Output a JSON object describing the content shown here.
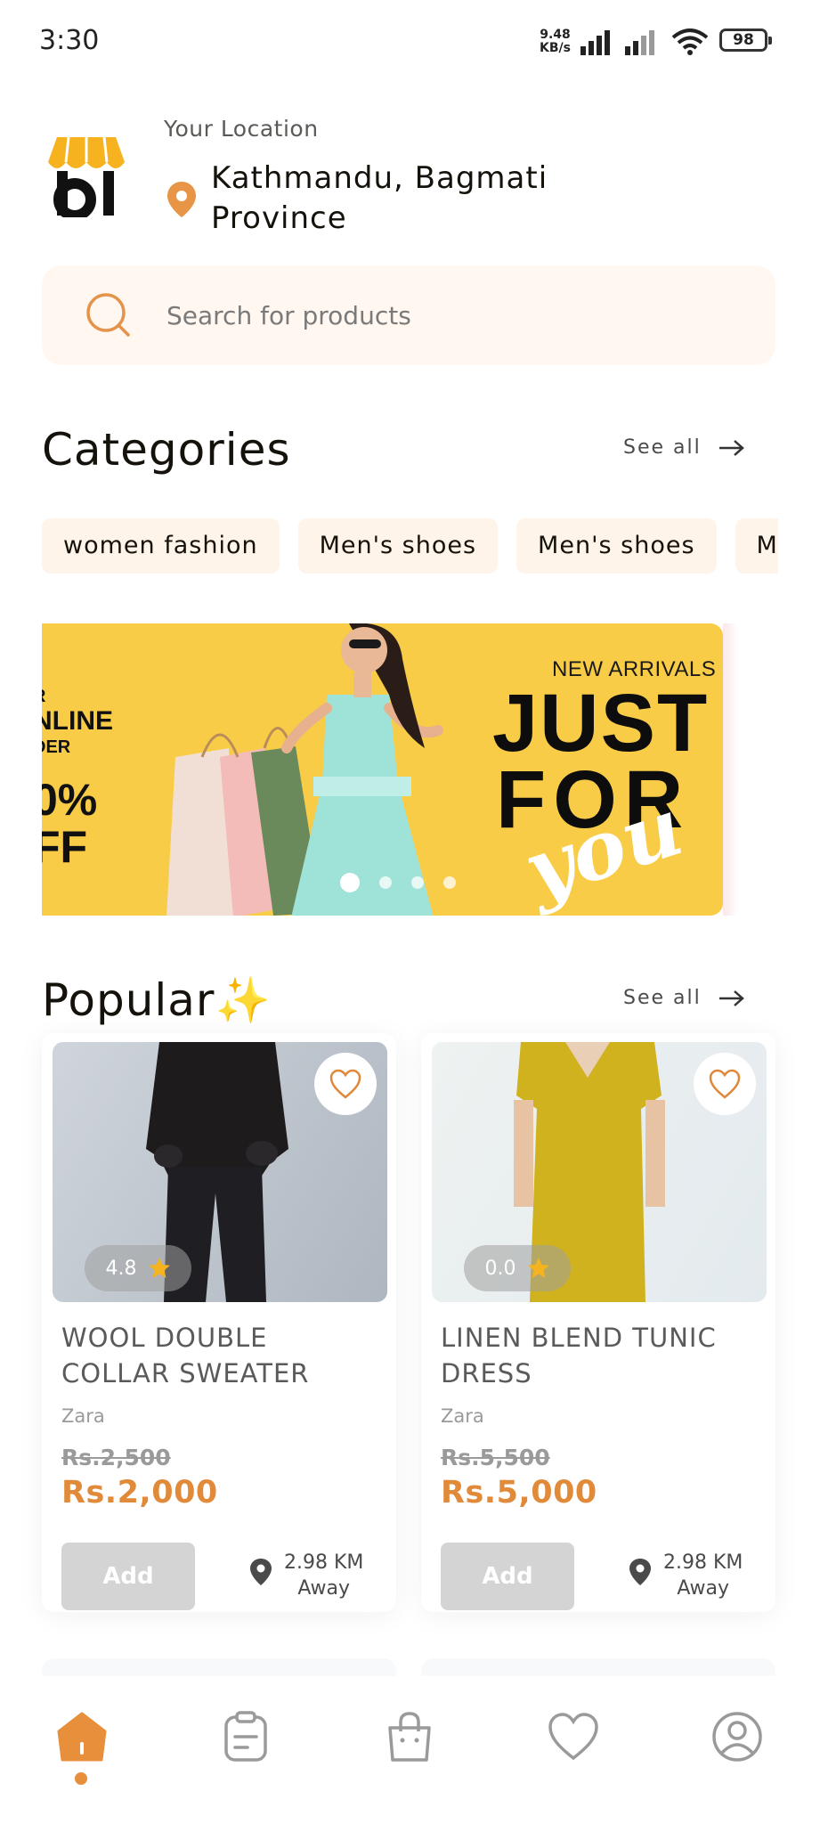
{
  "status_bar": {
    "time": "3:30",
    "net_speed_value": "9.48",
    "net_speed_unit": "KB/s",
    "battery": "98"
  },
  "header": {
    "location_label": "Your Location",
    "location_value": "Kathmandu, Bagmati Province"
  },
  "search": {
    "placeholder": "Search for products"
  },
  "categories": {
    "title": "Categories",
    "see_all": "See all",
    "items": [
      "women fashion",
      "Men's shoes",
      "Men's shoes",
      "Me"
    ]
  },
  "banner": {
    "left_line1": "R",
    "left_line2": "NLINE",
    "left_line3": "DER",
    "left_line4": "0%",
    "left_line5": "FF",
    "new_arrivals": "NEW ARRIVALS",
    "just": "JUST",
    "for": "FOR",
    "you": "you",
    "slide_count": 4,
    "active_slide": 1
  },
  "popular": {
    "title": "Popular",
    "emoji": "✨",
    "see_all": "See all",
    "products": [
      {
        "name": "WOOL DOUBLE COLLAR SWEATER",
        "brand": "Zara",
        "rating": "4.8",
        "old_price": "Rs.2,500",
        "price": "Rs.2,000",
        "add_label": "Add",
        "distance_line1": "2.98 KM",
        "distance_line2": "Away"
      },
      {
        "name": "LINEN BLEND TUNIC DRESS",
        "brand": "Zara",
        "rating": "0.0",
        "old_price": "Rs.5,500",
        "price": "Rs.5,000",
        "add_label": "Add",
        "distance_line1": "2.98 KM",
        "distance_line2": "Away"
      }
    ]
  },
  "colors": {
    "accent": "#e88f3c",
    "search_bg": "#fff7f0",
    "chip_bg": "#fff4ea",
    "banner_bg": "#f9cc47",
    "price": "#e08a3a"
  },
  "nav": {
    "items": [
      "home-icon",
      "orders-icon",
      "bag-icon",
      "heart-icon",
      "profile-icon"
    ],
    "active": "home-icon"
  }
}
